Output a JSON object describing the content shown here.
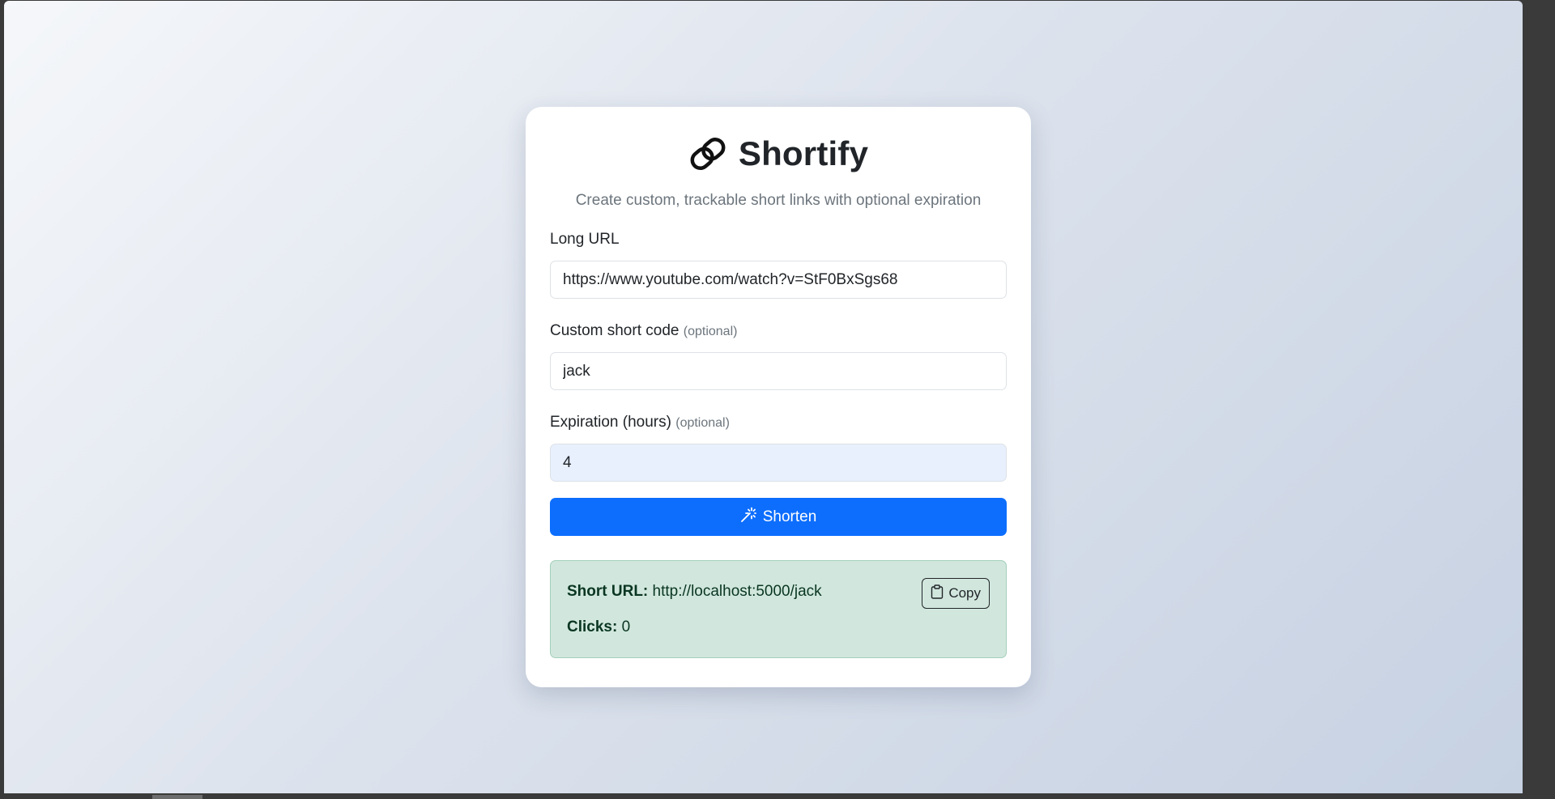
{
  "app": {
    "title": "Shortify",
    "subtitle": "Create custom, trackable short links with optional expiration"
  },
  "form": {
    "long_url": {
      "label": "Long URL",
      "value": "https://www.youtube.com/watch?v=StF0BxSgs68"
    },
    "short_code": {
      "label": "Custom short code",
      "optional": "(optional)",
      "value": "jack"
    },
    "expiration": {
      "label": "Expiration (hours)",
      "optional": "(optional)",
      "value": "4"
    },
    "submit_label": "Shorten"
  },
  "result": {
    "short_url_label": "Short URL:",
    "short_url": "http://localhost:5000/jack",
    "clicks_label": "Clicks:",
    "clicks": "0",
    "copy_label": "Copy"
  },
  "icons": {
    "logo": "link-icon",
    "submit": "magic-wand-icon",
    "copy": "clipboard-icon"
  },
  "colors": {
    "primary": "#0d6efd",
    "success_bg": "#d1e7dd",
    "success_text": "#0a3622",
    "autofill_bg": "#e8f0fe"
  }
}
